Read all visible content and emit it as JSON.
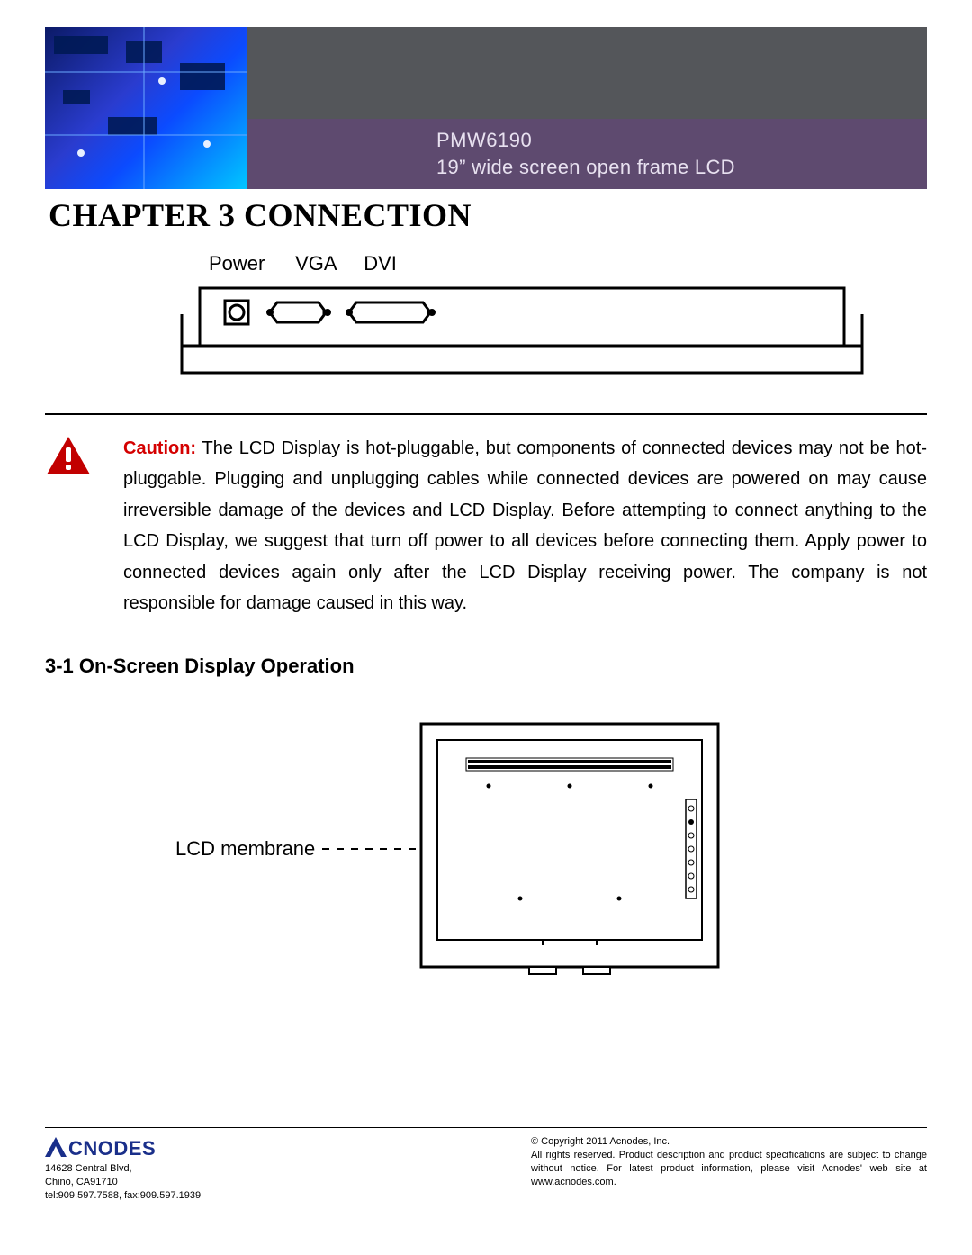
{
  "header": {
    "model": "PMW6190",
    "description": "19” wide screen open frame LCD"
  },
  "chapter_title": "CHAPTER 3 CONNECTION",
  "connection_diagram": {
    "labels": {
      "power": "Power",
      "vga": "VGA",
      "dvi": "DVI"
    }
  },
  "caution": {
    "label": "Caution:",
    "text": "The LCD Display is hot-pluggable, but components of connected devices may not be hot-pluggable. Plugging and unplugging cables while connected devices are powered on may cause irreversible damage of the devices and LCD Display. Before attempting to connect anything to the LCD Display, we suggest that turn off power to all devices before connecting them. Apply power to connected devices again only after the LCD Display receiving power. The company is not responsible for damage caused in this way."
  },
  "section_3_1": {
    "heading": "3-1  On-Screen Display Operation",
    "callout_label": "LCD membrane"
  },
  "footer": {
    "logo_text": "CNODES",
    "address_line1": "14628 Central Blvd,",
    "address_line2": "Chino, CA91710",
    "contact": "tel:909.597.7588, fax:909.597.1939",
    "copyright": "© Copyright 2011 Acnodes, Inc.",
    "legal": "All rights reserved. Product description and product specifications are subject to change without notice. For latest product information, please visit Acnodes' web site at www.acnodes.com."
  }
}
